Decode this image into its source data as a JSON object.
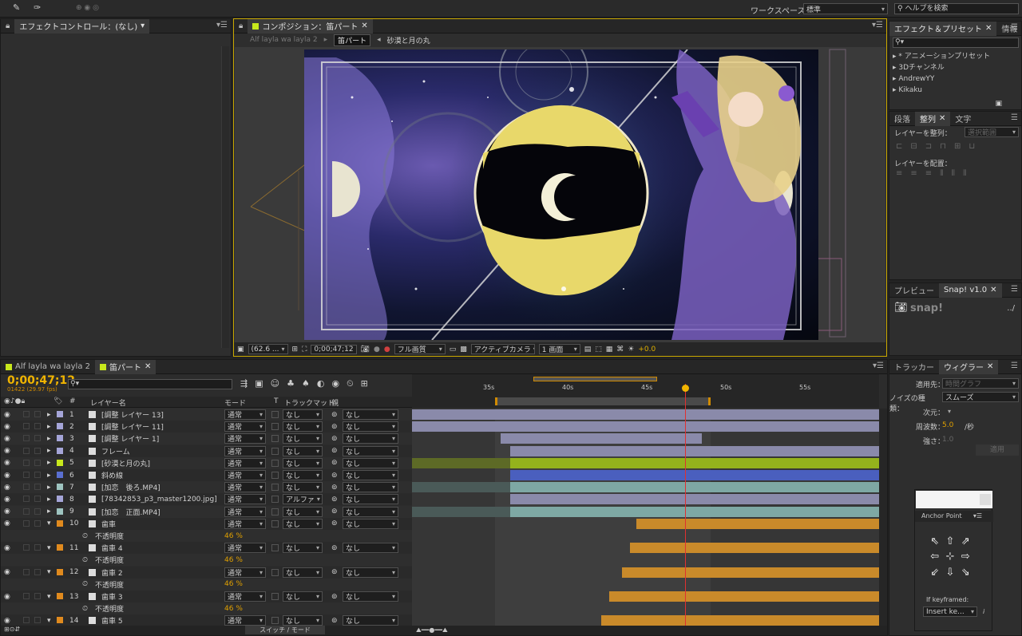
{
  "topbar": {
    "workspace_label": "ワークスペース：",
    "workspace_value": "標準",
    "help_placeholder": "ヘルプを検索"
  },
  "effect_controls": {
    "tab": "エフェクトコントロール：(なし)"
  },
  "composition": {
    "tab": "コンポジション：笛パート",
    "breadcrumb": [
      "Alf layla wa layla 2",
      "笛パート",
      "砂漠と月の丸"
    ],
    "footer": {
      "zoom": "(62.6 ...",
      "timecode": "0;00;47;12",
      "resolution": "フル画質",
      "camera": "アクティブカメラ",
      "views": "1 画面",
      "exposure": "+0.0"
    }
  },
  "effects_presets": {
    "tabs": [
      "エフェクト＆プリセット",
      "情報"
    ],
    "items": [
      "* アニメーションプリセット",
      "3Dチャンネル",
      "AndrewYY",
      "Kikaku"
    ]
  },
  "align": {
    "tabs": [
      "段落",
      "整列",
      "文字"
    ],
    "align_layers_label": "レイヤーを整列：",
    "align_target": "選択範囲",
    "distribute_label": "レイヤーを配置："
  },
  "preview": {
    "tabs": [
      "プレビュー",
      "Snap! v1.0"
    ],
    "logo": "snap!",
    "path": "../"
  },
  "wiggler": {
    "tabs": [
      "トラッカー",
      "ウィグラー"
    ],
    "apply_to_label": "適用先：",
    "apply_to": "時間グラフ",
    "noise_label": "ノイズの種類：",
    "noise": "スムーズ",
    "dim_label": "次元：",
    "freq_label": "周波数：",
    "freq": "5.0",
    "freq_unit": "/秒",
    "mag_label": "強さ：",
    "mag": "1.0",
    "apply_btn": "適用"
  },
  "anchor": {
    "title": "Anchor Point",
    "if_keyframed": "If keyframed:",
    "insert": "Insert ke..."
  },
  "timeline": {
    "tabs": [
      "Alf layla wa layla 2",
      "笛パート"
    ],
    "timecode": "0;00;47;12",
    "frames": "01422 (29.97 fps)",
    "headers": {
      "layer_name": "レイヤー名",
      "mode": "モード",
      "t": "T",
      "track_matte": "トラックマット",
      "parent": "親",
      "num": "#"
    },
    "ruler": [
      "35s",
      "40s",
      "45s",
      "50s",
      "55s"
    ],
    "footer_toggle": "スイッチ / モード",
    "layers": [
      {
        "num": "1",
        "name": "[調整 レイヤー 13]",
        "mode": "通常",
        "matte": "なし",
        "parent": "なし",
        "color": "#a5a5d8",
        "kind": "layer",
        "bar": "#8a8aaa",
        "start": 0.0,
        "end": 1.0
      },
      {
        "num": "2",
        "name": "[調整 レイヤー 11]",
        "mode": "通常",
        "matte": "なし",
        "parent": "なし",
        "color": "#a5a5d8",
        "kind": "layer",
        "bar": "#8a8aaa",
        "start": 0.0,
        "end": 1.0
      },
      {
        "num": "3",
        "name": "[調整 レイヤー 1]",
        "mode": "通常",
        "matte": "なし",
        "parent": "なし",
        "color": "#a5a5d8",
        "kind": "layer",
        "bar": "#8a8aaa",
        "start": 0.19,
        "end": 0.62
      },
      {
        "num": "4",
        "name": "フレーム",
        "mode": "通常",
        "matte": "なし",
        "parent": "なし",
        "color": "#a5a5d8",
        "kind": "layer",
        "bar": "#8a8aaa",
        "start": 0.21,
        "end": 1.0
      },
      {
        "num": "5",
        "name": "[砂漠と月の丸]",
        "mode": "通常",
        "matte": "なし",
        "parent": "なし",
        "color": "#c8e81c",
        "kind": "layer",
        "bar": "#94b21c",
        "start": 0.21,
        "end": 1.0,
        "pre": "#5d6a26"
      },
      {
        "num": "6",
        "name": "斜め線",
        "mode": "通常",
        "matte": "なし",
        "parent": "なし",
        "color": "#5a6fd0",
        "kind": "layer",
        "bar": "#4a5fbe",
        "start": 0.21,
        "end": 1.0
      },
      {
        "num": "7",
        "name": "[加恋　後ろ.MP4]",
        "mode": "通常",
        "matte": "なし",
        "parent": "なし",
        "color": "#9ec4c0",
        "kind": "layer",
        "bar": "#7ea8a4",
        "start": 0.21,
        "end": 1.0,
        "pre": "#4a5a58"
      },
      {
        "num": "8",
        "name": "[78342853_p3_master1200.jpg]",
        "mode": "通常",
        "matte": "アルファ",
        "parent": "なし",
        "color": "#a5a5d8",
        "kind": "layer",
        "bar": "#8a8aaa",
        "start": 0.21,
        "end": 1.0
      },
      {
        "num": "9",
        "name": "[加恋　正面.MP4]",
        "mode": "通常",
        "matte": "なし",
        "parent": "なし",
        "color": "#9ec4c0",
        "kind": "layer",
        "bar": "#7ea8a4",
        "start": 0.21,
        "end": 1.0,
        "pre": "#4a5a58"
      },
      {
        "num": "10",
        "name": "歯車",
        "mode": "通常",
        "matte": "なし",
        "parent": "なし",
        "color": "#e08a1e",
        "kind": "layer",
        "bar": "#c98a2a",
        "start": 0.48,
        "end": 1.0
      },
      {
        "kind": "prop",
        "name": "不透明度",
        "value": "46 %"
      },
      {
        "num": "11",
        "name": "歯車 4",
        "mode": "通常",
        "matte": "なし",
        "parent": "なし",
        "color": "#e08a1e",
        "kind": "layer",
        "bar": "#c98a2a",
        "start": 0.466,
        "end": 1.0
      },
      {
        "kind": "prop",
        "name": "不透明度",
        "value": "46 %"
      },
      {
        "num": "12",
        "name": "歯車 2",
        "mode": "通常",
        "matte": "なし",
        "parent": "なし",
        "color": "#e08a1e",
        "kind": "layer",
        "bar": "#c98a2a",
        "start": 0.45,
        "end": 1.0
      },
      {
        "kind": "prop",
        "name": "不透明度",
        "value": "46 %"
      },
      {
        "num": "13",
        "name": "歯車 3",
        "mode": "通常",
        "matte": "なし",
        "parent": "なし",
        "color": "#e08a1e",
        "kind": "layer",
        "bar": "#c98a2a",
        "start": 0.423,
        "end": 1.0
      },
      {
        "kind": "prop",
        "name": "不透明度",
        "value": "46 %"
      },
      {
        "num": "14",
        "name": "歯車 5",
        "mode": "通常",
        "matte": "なし",
        "parent": "なし",
        "color": "#e08a1e",
        "kind": "layer",
        "bar": "#c98a2a",
        "start": 0.405,
        "end": 1.0
      }
    ],
    "playhead_fraction": 0.585
  },
  "colors": {
    "accent": "#f0b400",
    "playhead": "#e03030",
    "label_yellow": "#c8e81c"
  }
}
